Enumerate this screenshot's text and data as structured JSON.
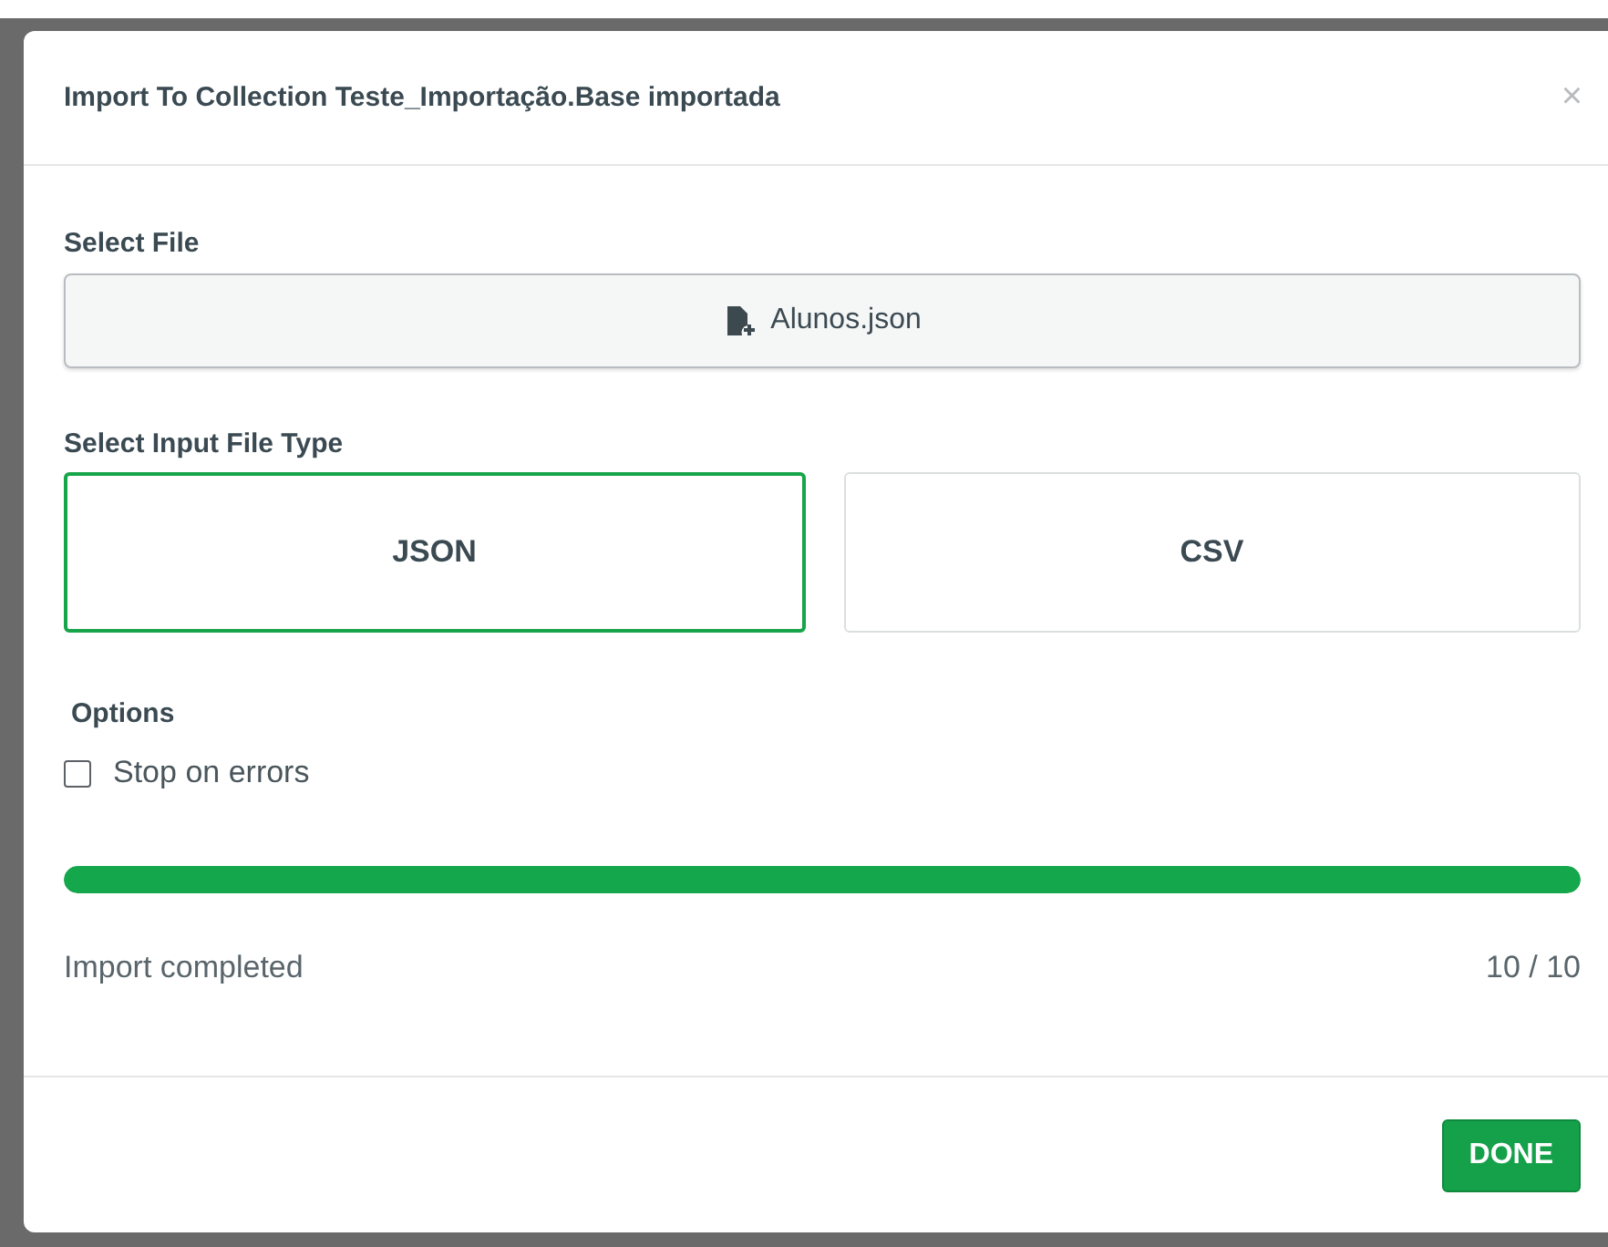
{
  "dialog": {
    "title": "Import To Collection Teste_Importação.Base importada",
    "close": "×"
  },
  "select_file": {
    "label": "Select File",
    "file": "Alunos.json"
  },
  "file_type": {
    "label": "Select Input File Type",
    "options": [
      {
        "label": "JSON",
        "selected": true
      },
      {
        "label": "CSV",
        "selected": false
      }
    ]
  },
  "options": {
    "label": "Options",
    "items": [
      {
        "label": "Stop on errors",
        "checked": false
      }
    ]
  },
  "progress": {
    "level": 1,
    "status": "Import completed",
    "count": "10 / 10"
  },
  "buttons": [
    {
      "label": "DONE"
    }
  ]
}
